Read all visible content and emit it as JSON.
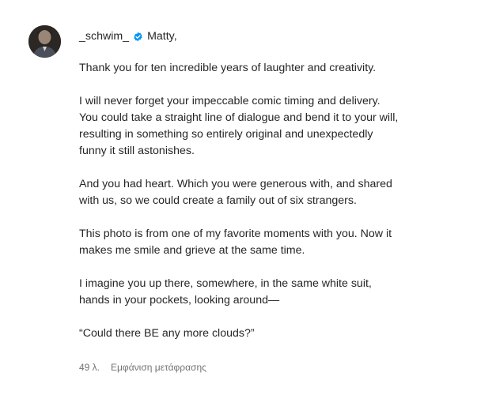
{
  "post": {
    "username": "_schwim_",
    "verified_icon": "verified-badge-icon",
    "greeting": "Matty,",
    "paragraphs": [
      "Thank you for ten incredible years of laughter and creativity.",
      "I will never forget your impeccable comic timing and delivery.\nYou could take a straight line of dialogue and bend it to your will,\nresulting in something so entirely original and unexpectedly\nfunny it still astonishes.",
      "And you had heart. Which you were generous with, and shared\nwith us, so we could create a family out of six strangers.",
      "This photo is from one of my favorite moments with you. Now it\nmakes me smile and grieve at the same time.",
      "I imagine you up there, somewhere, in the same white suit,\nhands in your pockets, looking around—",
      "“Could there BE any more clouds?”"
    ],
    "time_ago": "49 λ.",
    "see_translation": "Εμφάνιση μετάφρασης",
    "colors": {
      "text": "#262626",
      "secondary": "#737373",
      "verified": "#0095f6"
    }
  }
}
